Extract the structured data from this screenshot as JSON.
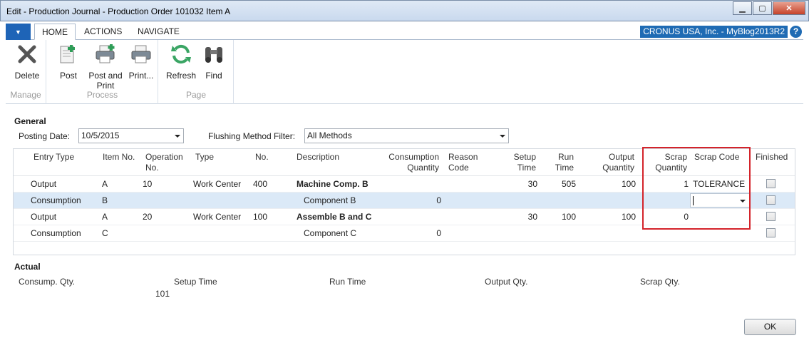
{
  "window": {
    "title": "Edit - Production Journal - Production Order 101032 Item A",
    "minimize": "▁",
    "maximize": "▢",
    "close": "✕"
  },
  "ribbon_tabs": [
    "HOME",
    "ACTIONS",
    "NAVIGATE"
  ],
  "company": "CRONUS USA, Inc. - MyBlog2013R2",
  "help": "?",
  "ribbon": {
    "manage": {
      "group": "Manage",
      "delete": "Delete"
    },
    "process": {
      "group": "Process",
      "post": "Post",
      "post_print_1": "Post and",
      "post_print_2": "Print",
      "print": "Print..."
    },
    "page": {
      "group": "Page",
      "refresh": "Refresh",
      "find": "Find"
    }
  },
  "general": {
    "title": "General",
    "posting_date_label": "Posting Date:",
    "posting_date": "10/5/2015",
    "flushing_label": "Flushing Method Filter:",
    "flushing_value": "All Methods"
  },
  "grid": {
    "headers": {
      "entry_type": "Entry Type",
      "item_no": "Item No.",
      "operation_no_1": "Operation",
      "operation_no_2": "No.",
      "type": "Type",
      "no": "No.",
      "description": "Description",
      "consumption_qty_1": "Consumption",
      "consumption_qty_2": "Quantity",
      "reason_code_1": "Reason",
      "reason_code_2": "Code",
      "setup_time_1": "Setup",
      "setup_time_2": "Time",
      "run_time_1": "Run",
      "run_time_2": "Time",
      "output_qty_1": "Output",
      "output_qty_2": "Quantity",
      "scrap_qty_1": "Scrap",
      "scrap_qty_2": "Quantity",
      "scrap_code": "Scrap Code",
      "finished": "Finished"
    },
    "rows": [
      {
        "entry_type": "Output",
        "item_no": "A",
        "operation_no": "10",
        "type": "Work Center",
        "no": "400",
        "description": "Machine Comp. B",
        "consumption_qty": "",
        "setup_time": "30",
        "run_time": "505",
        "output_qty": "100",
        "scrap_qty": "1",
        "scrap_code": "TOLERANCE"
      },
      {
        "entry_type": "Consumption",
        "item_no": "B",
        "operation_no": "",
        "type": "",
        "no": "",
        "description": "Component B",
        "consumption_qty": "0",
        "setup_time": "",
        "run_time": "",
        "output_qty": "",
        "scrap_qty": "",
        "scrap_code": ""
      },
      {
        "entry_type": "Output",
        "item_no": "A",
        "operation_no": "20",
        "type": "Work Center",
        "no": "100",
        "description": "Assemble B and C",
        "consumption_qty": "",
        "setup_time": "30",
        "run_time": "100",
        "output_qty": "100",
        "scrap_qty": "0",
        "scrap_code": ""
      },
      {
        "entry_type": "Consumption",
        "item_no": "C",
        "operation_no": "",
        "type": "",
        "no": "",
        "description": "Component C",
        "consumption_qty": "0",
        "setup_time": "",
        "run_time": "",
        "output_qty": "",
        "scrap_qty": "",
        "scrap_code": ""
      }
    ]
  },
  "actual": {
    "title": "Actual",
    "consump_qty_label": "Consump. Qty.",
    "consump_qty_value": "101",
    "setup_time_label": "Setup Time",
    "run_time_label": "Run Time",
    "output_qty_label": "Output Qty.",
    "scrap_qty_label": "Scrap Qty."
  },
  "ok_button": "OK",
  "colors": {
    "accent": "#1f6bb4",
    "selected_row": "#dbe9f7",
    "highlight_box": "#d4232a"
  }
}
